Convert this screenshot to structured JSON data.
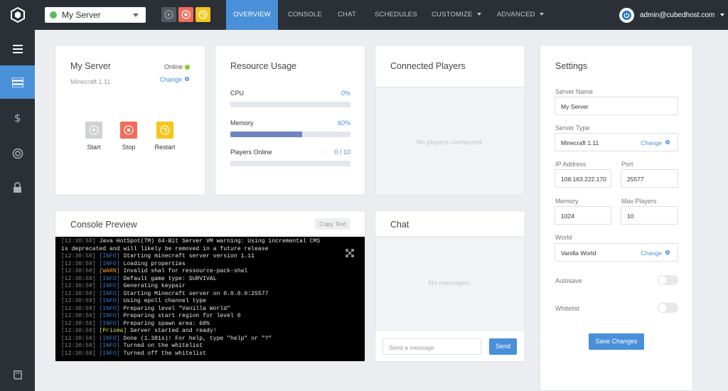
{
  "topbar": {
    "server_select": "My Server",
    "nav": [
      "OVERVIEW",
      "CONSOLE",
      "CHAT",
      "SCHEDULES",
      "CUSTOMIZE",
      "ADVANCED"
    ],
    "user_email": "admin@cubedhost.com"
  },
  "server_card": {
    "title": "My Server",
    "status": "Online",
    "version": "Minecraft 1.11",
    "change": "Change",
    "controls": {
      "start": "Start",
      "stop": "Stop",
      "restart": "Restart"
    }
  },
  "resources": {
    "title": "Resource Usage",
    "cpu_label": "CPU",
    "cpu_value": "0%",
    "cpu_fraction": 0,
    "memory_label": "Memory",
    "memory_value": "60%",
    "memory_fraction": 0.6,
    "players_label": "Players Online",
    "players_value": "0 / 10",
    "players_fraction": 0
  },
  "players": {
    "title": "Connected Players",
    "empty": "No players connected."
  },
  "console": {
    "title": "Console Preview",
    "copy": "Copy Text",
    "lines": [
      {
        "ts": "[12:30:58]",
        "level": "",
        "text": "Java HotSpot(TM) 64-Bit Server VM warning: Using incremental CMS"
      },
      {
        "ts": "",
        "level": "",
        "text": "is deprecated and will likely be removed in a future release"
      },
      {
        "ts": "[12:30:58]",
        "level": "INFO",
        "text": "Starting minecraft server version 1.11"
      },
      {
        "ts": "[12:30:58]",
        "level": "INFO",
        "text": "Loading properties"
      },
      {
        "ts": "[12:30:58]",
        "level": "WARN",
        "text": "Invalid shal for ressource-pack-shal"
      },
      {
        "ts": "[12:30:58]",
        "level": "INFO",
        "text": "Default game type: SURVIVAL"
      },
      {
        "ts": "[12:30:58]",
        "level": "INFO",
        "text": "Generating keypair"
      },
      {
        "ts": "[12:30:58]",
        "level": "INFO",
        "text": "Starting Minecraft server on 0.0.0.0:25577"
      },
      {
        "ts": "[12:30:58]",
        "level": "INFO",
        "text": "Using epoll channel type"
      },
      {
        "ts": "[12:30:58]",
        "level": "INFO",
        "text": "Preparing level \"Vanilla World\""
      },
      {
        "ts": "[12:30:58]",
        "level": "INFO",
        "text": "Preparing start region for level 0"
      },
      {
        "ts": "[12:30:58]",
        "level": "INFO",
        "text": "Preparing spawn area: 68%"
      },
      {
        "ts": "[12:30:58]",
        "level": "Prisma",
        "text": "Server started and ready!"
      },
      {
        "ts": "[12:30:58]",
        "level": "INFO",
        "text": "Done (1.381s)! For help, type \"help\" or \"?\""
      },
      {
        "ts": "[12:30:58]",
        "level": "INFO",
        "text": "Turned on the whitelist"
      },
      {
        "ts": "[12:30:58]",
        "level": "INFO",
        "text": "Turned off the whitelist"
      }
    ]
  },
  "chat": {
    "title": "Chat",
    "empty": "No messages.",
    "placeholder": "Send a message",
    "send": "Send"
  },
  "settings": {
    "title": "Settings",
    "server_name_label": "Server Name",
    "server_name": "My Server",
    "server_type_label": "Server Type",
    "server_type": "Minecraft 1.11",
    "server_type_change": "Change",
    "ip_label": "IP Address",
    "ip": "108.163.222.170",
    "port_label": "Port",
    "port": "25577",
    "memory_label": "Memory",
    "memory": "1024",
    "max_players_label": "Max Players",
    "max_players": "10",
    "world_label": "World",
    "world": "Vanilla World",
    "world_change": "Change",
    "autosave_label": "Autosave",
    "whitelist_label": "Whitelist",
    "save": "Save Changes"
  },
  "colors": {
    "accent": "#4a90d9",
    "dark": "#2b2f36",
    "online": "#7ed321",
    "start": "#cfd1d4",
    "stop": "#f26b5b",
    "restart": "#f5c518"
  },
  "icons": {
    "logo": "cube-logo-icon",
    "sidebar": [
      "menu-icon",
      "server-list-icon",
      "dollar-icon",
      "lifebuoy-icon",
      "lock-icon",
      "book-icon"
    ]
  }
}
